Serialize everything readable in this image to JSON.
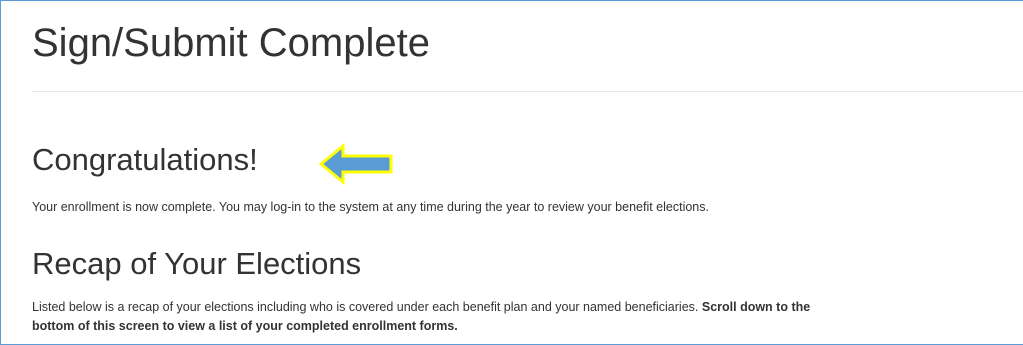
{
  "page": {
    "title": "Sign/Submit Complete"
  },
  "congratulations": {
    "heading": "Congratulations!",
    "message": "Your enrollment is now complete. You may log-in to the system at any time during the year to review your benefit elections."
  },
  "recap": {
    "heading": "Recap of Your Elections",
    "intro": "Listed below is a recap of your elections including who is covered under each benefit plan and your named beneficiaries. ",
    "emphasis_line1": "Scroll down to the",
    "emphasis_line2": "bottom of this screen to view a list of your completed enrollment forms."
  },
  "annotation": {
    "icon": "left-arrow-icon",
    "fill_color": "#5b9bd5",
    "outline_color": "#ffff00"
  }
}
